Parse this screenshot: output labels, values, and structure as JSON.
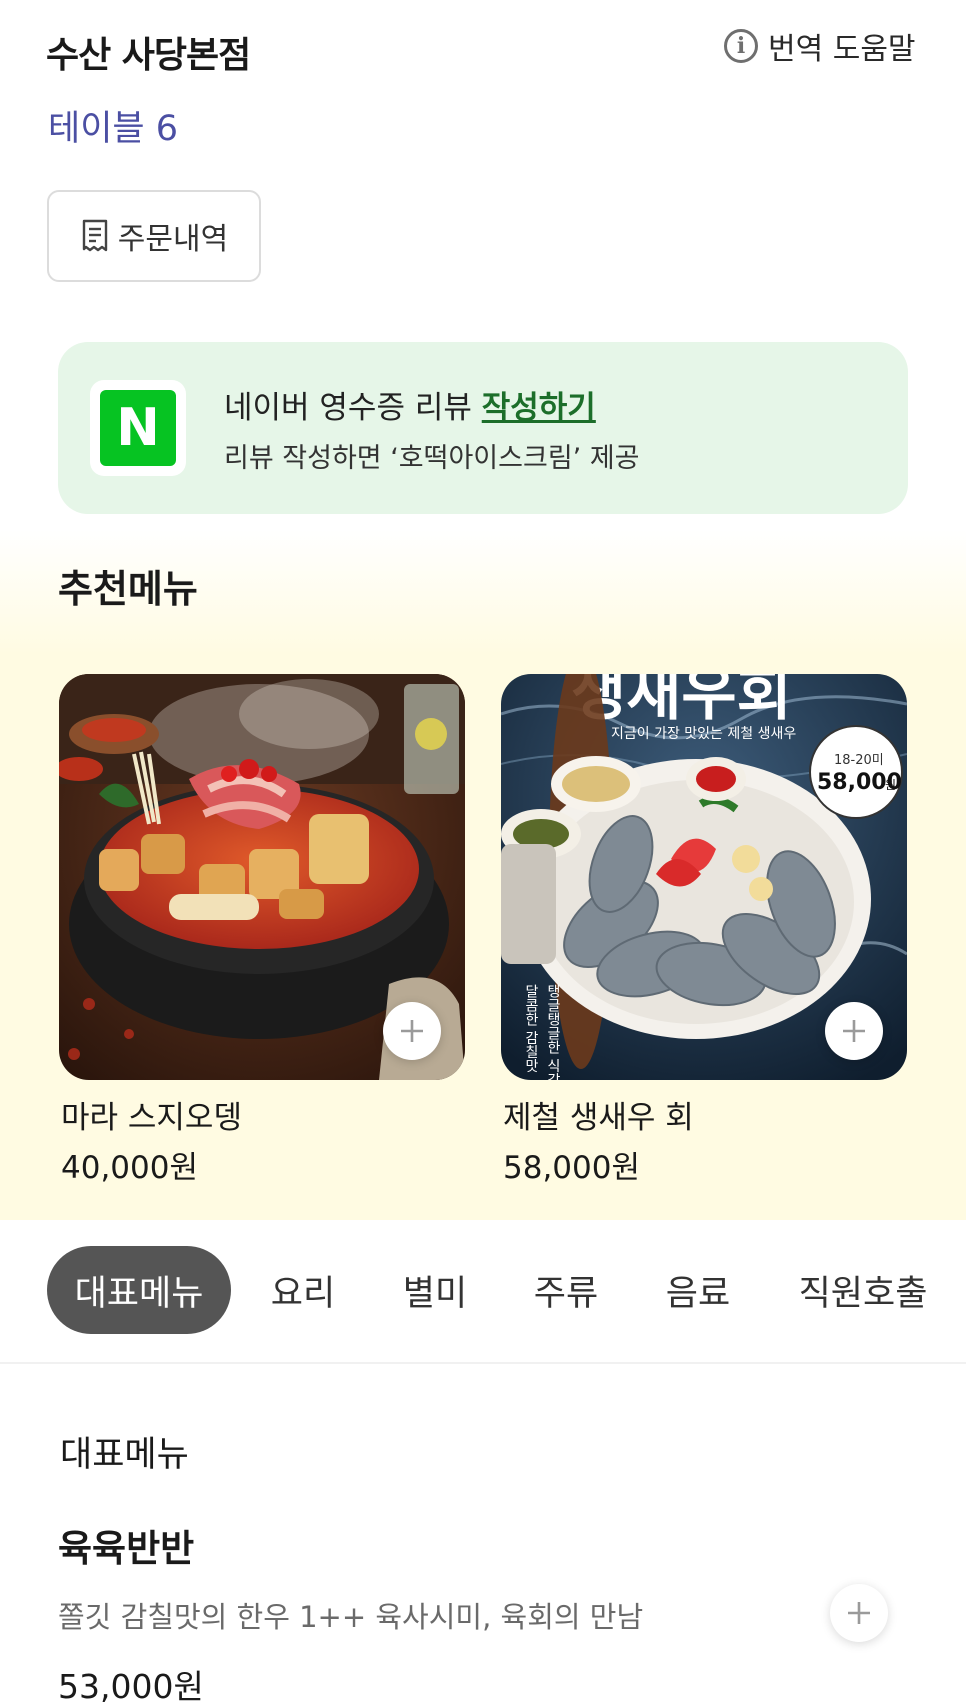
{
  "header": {
    "store_name": "수산 사당본점",
    "help_label": "번역 도움말",
    "help_icon": "info-icon",
    "table_label": "테이블 6"
  },
  "order_history": {
    "label": "주문내역",
    "icon": "receipt-icon"
  },
  "review_banner": {
    "logo_letter": "N",
    "title_prefix": "네이버 영수증 리뷰 ",
    "title_link": "작성하기",
    "subtitle": "리뷰 작성하면 ‘호떡아이스크림’ 제공",
    "colors": {
      "background": "#e6f6e8",
      "logo": "#06c322",
      "link": "#1c6e2a"
    }
  },
  "recommended": {
    "title": "추천메뉴",
    "items": [
      {
        "name": "마라 스지오뎅",
        "price": "40,000원"
      },
      {
        "name": "제철 생새우 회",
        "price": "58,000원",
        "image_text": {
          "headline": "생새우회",
          "tagline": "지금이 가장 맛있는 제철 생새우",
          "badge_count": "18-20미",
          "badge_price": "58,000",
          "badge_unit": "원",
          "side_text_1": "탱글탱글한 식감",
          "side_text_2": "달콤한 감칠맛"
        }
      }
    ]
  },
  "tabs": [
    {
      "label": "대표메뉴",
      "active": true
    },
    {
      "label": "요리",
      "active": false
    },
    {
      "label": "별미",
      "active": false
    },
    {
      "label": "주류",
      "active": false
    },
    {
      "label": "음료",
      "active": false
    },
    {
      "label": "직원호출",
      "active": false
    }
  ],
  "menu": {
    "section_title": "대표메뉴",
    "items": [
      {
        "name": "육육반반",
        "description": "쫄깃 감칠맛의 한우 1++ 육사시미, 육회의 만남",
        "price": "53,000원"
      }
    ]
  },
  "colors": {
    "accent_table": "#4b4fa3",
    "active_tab": "#555555",
    "reco_background": "#fffbe2"
  }
}
